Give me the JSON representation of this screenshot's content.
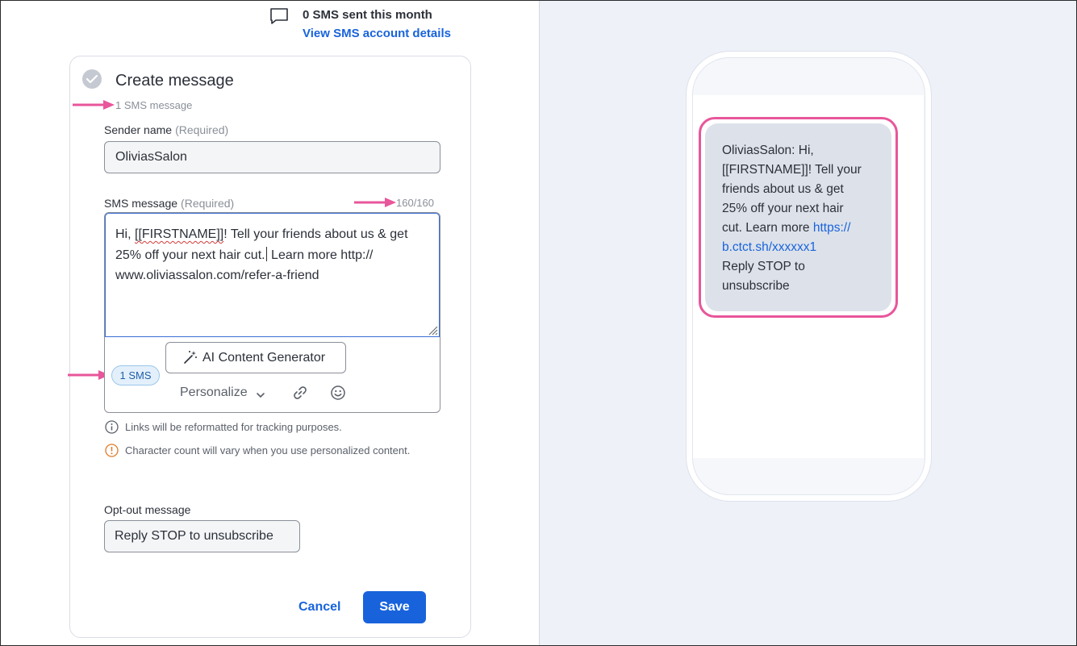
{
  "header": {
    "sms_sent": "0 SMS sent this month",
    "account_link": "View SMS account details"
  },
  "card": {
    "title": "Create message",
    "subtitle": "1 SMS message",
    "sender": {
      "label": "Sender name",
      "required": "(Required)",
      "value": "OliviasSalon"
    },
    "sms": {
      "label": "SMS message",
      "required": "(Required)",
      "char_count": "160/160",
      "text_prefix": "Hi, ",
      "text_token": "[[FIRSTNAME]]",
      "text_line1_rest": "! Tell your friends about us & get",
      "text_line2a": "25% off your next hair cut.",
      "text_line2b": " Learn more http://",
      "text_line3": "www.oliviassalon.com/refer-a-friend",
      "sms_count_badge": "1 SMS",
      "ai_button": "AI Content Generator",
      "personalize": "Personalize"
    },
    "notes": {
      "links": "Links will be reformatted for tracking purposes.",
      "character_count": "Character count will vary when you use personalized content."
    },
    "optout": {
      "label": "Opt-out message",
      "value": "Reply STOP to unsubscribe"
    },
    "actions": {
      "cancel": "Cancel",
      "save": "Save"
    }
  },
  "preview": {
    "line1": "OliviasSalon: Hi,",
    "line2": "[[FIRSTNAME]]! Tell your",
    "line3": "friends about us & get",
    "line4": "25% off your next hair",
    "line5_text": "cut. Learn more ",
    "line5_link": "https://",
    "line6_link": "b.ctct.sh/xxxxxx1",
    "line7": "Reply STOP to",
    "line8": "unsubscribe"
  },
  "colors": {
    "brand_blue": "#1863dc",
    "annotation_pink": "#e8569b",
    "preview_background": "#eef1f8",
    "bubble": "#dde2ea"
  },
  "icons": [
    "chat-bubble-icon",
    "check-circle-icon",
    "magic-wand-icon",
    "chevron-down-icon",
    "link-icon",
    "emoji-icon",
    "info-icon",
    "warning-icon",
    "resize-handle-icon"
  ]
}
